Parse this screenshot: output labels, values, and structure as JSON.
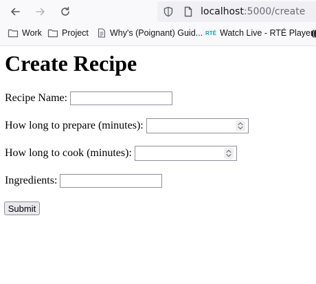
{
  "browser": {
    "url_host": "localhost",
    "url_port_path": ":5000/create",
    "bookmarks": [
      {
        "label": "Work",
        "icon": "folder-icon"
      },
      {
        "label": "Project",
        "icon": "folder-icon"
      },
      {
        "label": "Why's (Poignant) Guid...",
        "icon": "page-icon"
      },
      {
        "label": "Watch Live - RTÉ Player",
        "icon": "rte-icon",
        "badge": "RTÉ"
      }
    ]
  },
  "form": {
    "title": "Create Recipe",
    "recipe_name_label": "Recipe Name:",
    "prep_time_label": "How long to prepare (minutes):",
    "cook_time_label": "How long to cook (minutes):",
    "ingredients_label": "Ingredients:",
    "submit_label": "Submit"
  }
}
